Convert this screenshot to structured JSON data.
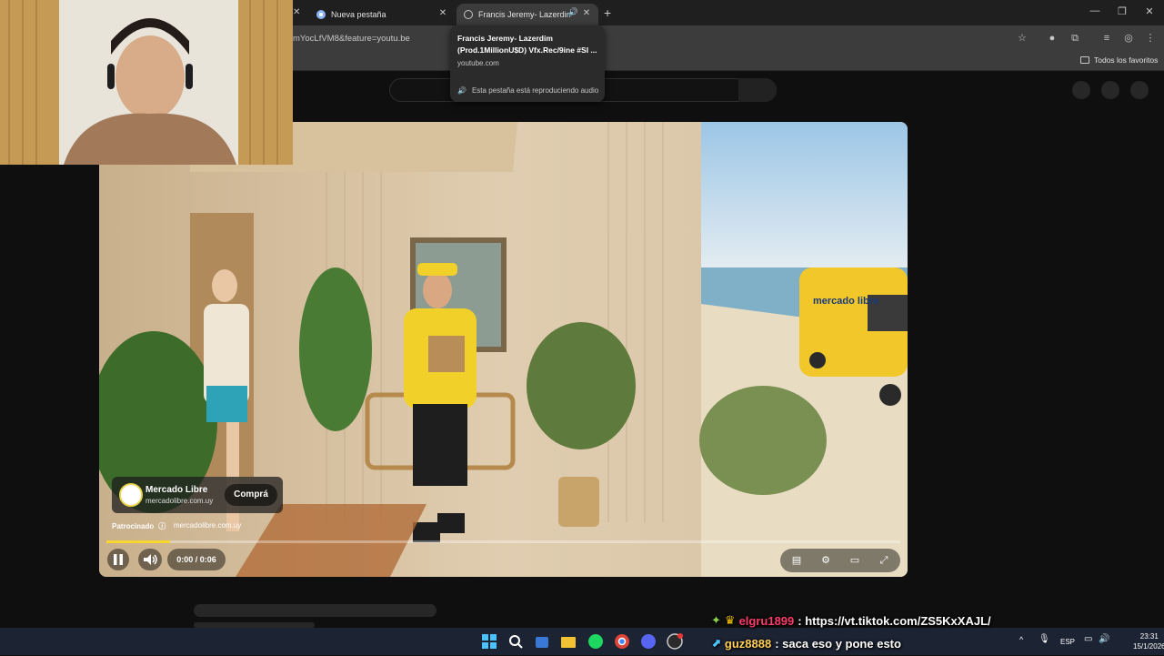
{
  "browser": {
    "tabs": [
      {
        "label": ""
      },
      {
        "label": "Nueva pestaña"
      },
      {
        "label": "Francis Jeremy- Lazerdim (Pr"
      }
    ],
    "url": "mYocLfVM8&feature=youtu.be",
    "bookmarks_label": "Todos los favoritos"
  },
  "tooltip": {
    "title": "Francis Jeremy- Lazerdim (Prod.1MillionU$D) Vfx.Rec/9ine #SI ...",
    "domain": "youtube.com",
    "audio_text": "Esta pestaña está reproduciendo audio"
  },
  "player": {
    "ad": {
      "brand": "Mercado Libre",
      "domain": "mercadolibre.com.uy",
      "cta": "Comprá",
      "sponsored_label": "Patrocinado",
      "sponsored_url": "mercadolibre.com.uy"
    },
    "time": "0:00 / 0:06",
    "progress": 0.08,
    "van_text": "mercado libre"
  },
  "chat": [
    {
      "user": "elgru1899",
      "message": ": https://vt.tiktok.com/ZS5KxXAJL/"
    },
    {
      "user": "guz8888",
      "message": ": saca eso y pone esto"
    }
  ],
  "taskbar": {
    "lang": "ESP",
    "time": "23:31",
    "date": "15/1/2026"
  }
}
